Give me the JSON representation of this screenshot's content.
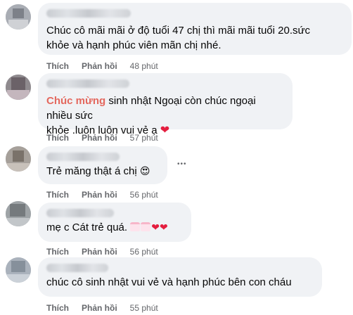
{
  "labels": {
    "like": "Thích",
    "reply": "Phản hồi",
    "more": "•••"
  },
  "comments": [
    {
      "lines": [
        "Chúc cô mãi mãi ở độ tuổi 47 chị thì mãi mãi tuổi 20.sức",
        "khỏe và hạnh phúc viên mãn chị nhé."
      ],
      "time": "48 phút"
    },
    {
      "highlight": "Chúc mừng",
      "lines": [
        " sinh nhật Ngoại còn chúc ngoại nhiều sức",
        "khỏe .luôn luôn vui vẻ ạ"
      ],
      "time": "57 phút"
    },
    {
      "lines": [
        "Trẻ măng thật á chị"
      ],
      "time": "56 phút"
    },
    {
      "lines": [
        "mẹ c Cát trẻ quá."
      ],
      "time": "56 phút"
    },
    {
      "lines": [
        "chúc cô sinh nhật vui vẻ và hạnh phúc bên con cháu"
      ],
      "time": "55 phút"
    }
  ],
  "colors": {
    "bubble": "#f0f2f5",
    "highlight": "#e4685e",
    "meta": "#65676b",
    "heart": "#e41e3f"
  },
  "icons": [
    "heart-emoji",
    "heart-eyes-emoji",
    "birthday-cake-emoji",
    "sparkling-heart-emoji",
    "more-options-icon"
  ]
}
